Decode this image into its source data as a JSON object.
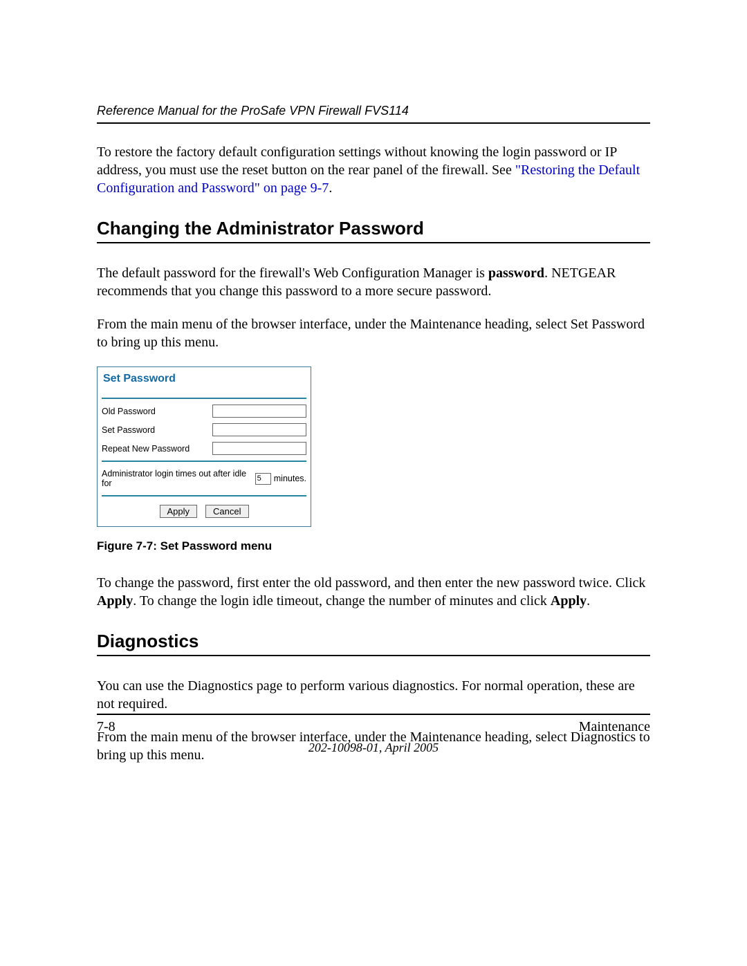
{
  "header": {
    "title": "Reference Manual for the ProSafe VPN Firewall FVS114"
  },
  "intro": {
    "text_before_link": "To restore the factory default configuration settings without knowing the login password or IP address, you must use the reset button on the rear panel of the firewall. See ",
    "link_text": "\"Restoring the Default Configuration and Password\" on page 9-7",
    "text_after_link": "."
  },
  "section1": {
    "heading": "Changing the Administrator Password",
    "p1_a": "The default password for the firewall's Web Configuration Manager is ",
    "p1_bold": "password",
    "p1_b": ". NETGEAR recommends that you change this password to a more secure password.",
    "p2": "From the main menu of the browser interface, under the Maintenance heading, select Set Password to bring up this menu."
  },
  "panel": {
    "title": "Set Password",
    "labels": {
      "old": "Old Password",
      "set": "Set Password",
      "repeat": "Repeat New Password",
      "idle_before": "Administrator login times out after idle for",
      "idle_value": "5",
      "idle_after": "minutes."
    },
    "buttons": {
      "apply": "Apply",
      "cancel": "Cancel"
    }
  },
  "figure_caption": "Figure 7-7:  Set Password menu",
  "section1b": {
    "p_a": "To change the password, first enter the old password, and then enter the new password twice. Click ",
    "bold1": "Apply",
    "p_b": ". To change the login idle timeout, change the number of minutes and click ",
    "bold2": "Apply",
    "p_c": "."
  },
  "section2": {
    "heading": "Diagnostics",
    "p1": "You can use the Diagnostics page to perform various diagnostics. For normal operation, these are not required.",
    "p2": "From the main menu of the browser interface, under the Maintenance heading, select Diagnostics to bring up this menu."
  },
  "footer": {
    "left": "7-8",
    "right": "Maintenance",
    "center": "202-10098-01, April 2005"
  }
}
